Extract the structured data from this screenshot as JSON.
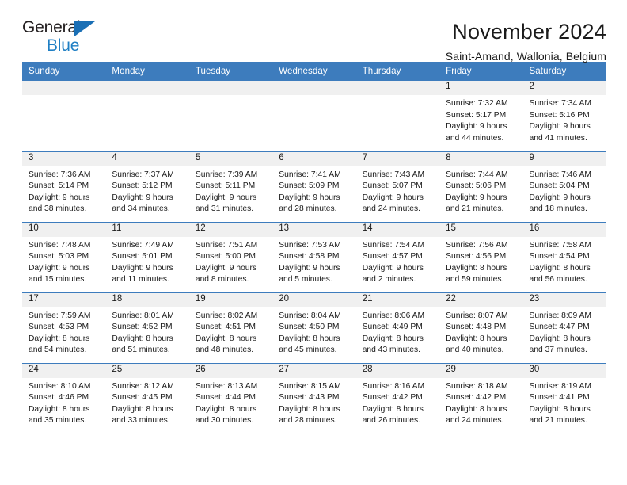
{
  "brand": {
    "name_part1": "General",
    "name_part2": "Blue",
    "triangle_icon": "brand-triangle-icon",
    "accent_color": "#1a6fb5"
  },
  "header": {
    "title": "November 2024",
    "subtitle": "Saint-Amand, Wallonia, Belgium"
  },
  "calendar": {
    "header_color": "#3d7cbd",
    "daynum_strip_color": "#f0f0f0",
    "weekday_headers": [
      "Sunday",
      "Monday",
      "Tuesday",
      "Wednesday",
      "Thursday",
      "Friday",
      "Saturday"
    ],
    "weeks": [
      [
        {
          "day": "",
          "empty": true
        },
        {
          "day": "",
          "empty": true
        },
        {
          "day": "",
          "empty": true
        },
        {
          "day": "",
          "empty": true
        },
        {
          "day": "",
          "empty": true
        },
        {
          "day": "1",
          "sunrise": "Sunrise: 7:32 AM",
          "sunset": "Sunset: 5:17 PM",
          "daylight": "Daylight: 9 hours and 44 minutes."
        },
        {
          "day": "2",
          "sunrise": "Sunrise: 7:34 AM",
          "sunset": "Sunset: 5:16 PM",
          "daylight": "Daylight: 9 hours and 41 minutes."
        }
      ],
      [
        {
          "day": "3",
          "sunrise": "Sunrise: 7:36 AM",
          "sunset": "Sunset: 5:14 PM",
          "daylight": "Daylight: 9 hours and 38 minutes."
        },
        {
          "day": "4",
          "sunrise": "Sunrise: 7:37 AM",
          "sunset": "Sunset: 5:12 PM",
          "daylight": "Daylight: 9 hours and 34 minutes."
        },
        {
          "day": "5",
          "sunrise": "Sunrise: 7:39 AM",
          "sunset": "Sunset: 5:11 PM",
          "daylight": "Daylight: 9 hours and 31 minutes."
        },
        {
          "day": "6",
          "sunrise": "Sunrise: 7:41 AM",
          "sunset": "Sunset: 5:09 PM",
          "daylight": "Daylight: 9 hours and 28 minutes."
        },
        {
          "day": "7",
          "sunrise": "Sunrise: 7:43 AM",
          "sunset": "Sunset: 5:07 PM",
          "daylight": "Daylight: 9 hours and 24 minutes."
        },
        {
          "day": "8",
          "sunrise": "Sunrise: 7:44 AM",
          "sunset": "Sunset: 5:06 PM",
          "daylight": "Daylight: 9 hours and 21 minutes."
        },
        {
          "day": "9",
          "sunrise": "Sunrise: 7:46 AM",
          "sunset": "Sunset: 5:04 PM",
          "daylight": "Daylight: 9 hours and 18 minutes."
        }
      ],
      [
        {
          "day": "10",
          "sunrise": "Sunrise: 7:48 AM",
          "sunset": "Sunset: 5:03 PM",
          "daylight": "Daylight: 9 hours and 15 minutes."
        },
        {
          "day": "11",
          "sunrise": "Sunrise: 7:49 AM",
          "sunset": "Sunset: 5:01 PM",
          "daylight": "Daylight: 9 hours and 11 minutes."
        },
        {
          "day": "12",
          "sunrise": "Sunrise: 7:51 AM",
          "sunset": "Sunset: 5:00 PM",
          "daylight": "Daylight: 9 hours and 8 minutes."
        },
        {
          "day": "13",
          "sunrise": "Sunrise: 7:53 AM",
          "sunset": "Sunset: 4:58 PM",
          "daylight": "Daylight: 9 hours and 5 minutes."
        },
        {
          "day": "14",
          "sunrise": "Sunrise: 7:54 AM",
          "sunset": "Sunset: 4:57 PM",
          "daylight": "Daylight: 9 hours and 2 minutes."
        },
        {
          "day": "15",
          "sunrise": "Sunrise: 7:56 AM",
          "sunset": "Sunset: 4:56 PM",
          "daylight": "Daylight: 8 hours and 59 minutes."
        },
        {
          "day": "16",
          "sunrise": "Sunrise: 7:58 AM",
          "sunset": "Sunset: 4:54 PM",
          "daylight": "Daylight: 8 hours and 56 minutes."
        }
      ],
      [
        {
          "day": "17",
          "sunrise": "Sunrise: 7:59 AM",
          "sunset": "Sunset: 4:53 PM",
          "daylight": "Daylight: 8 hours and 54 minutes."
        },
        {
          "day": "18",
          "sunrise": "Sunrise: 8:01 AM",
          "sunset": "Sunset: 4:52 PM",
          "daylight": "Daylight: 8 hours and 51 minutes."
        },
        {
          "day": "19",
          "sunrise": "Sunrise: 8:02 AM",
          "sunset": "Sunset: 4:51 PM",
          "daylight": "Daylight: 8 hours and 48 minutes."
        },
        {
          "day": "20",
          "sunrise": "Sunrise: 8:04 AM",
          "sunset": "Sunset: 4:50 PM",
          "daylight": "Daylight: 8 hours and 45 minutes."
        },
        {
          "day": "21",
          "sunrise": "Sunrise: 8:06 AM",
          "sunset": "Sunset: 4:49 PM",
          "daylight": "Daylight: 8 hours and 43 minutes."
        },
        {
          "day": "22",
          "sunrise": "Sunrise: 8:07 AM",
          "sunset": "Sunset: 4:48 PM",
          "daylight": "Daylight: 8 hours and 40 minutes."
        },
        {
          "day": "23",
          "sunrise": "Sunrise: 8:09 AM",
          "sunset": "Sunset: 4:47 PM",
          "daylight": "Daylight: 8 hours and 37 minutes."
        }
      ],
      [
        {
          "day": "24",
          "sunrise": "Sunrise: 8:10 AM",
          "sunset": "Sunset: 4:46 PM",
          "daylight": "Daylight: 8 hours and 35 minutes."
        },
        {
          "day": "25",
          "sunrise": "Sunrise: 8:12 AM",
          "sunset": "Sunset: 4:45 PM",
          "daylight": "Daylight: 8 hours and 33 minutes."
        },
        {
          "day": "26",
          "sunrise": "Sunrise: 8:13 AM",
          "sunset": "Sunset: 4:44 PM",
          "daylight": "Daylight: 8 hours and 30 minutes."
        },
        {
          "day": "27",
          "sunrise": "Sunrise: 8:15 AM",
          "sunset": "Sunset: 4:43 PM",
          "daylight": "Daylight: 8 hours and 28 minutes."
        },
        {
          "day": "28",
          "sunrise": "Sunrise: 8:16 AM",
          "sunset": "Sunset: 4:42 PM",
          "daylight": "Daylight: 8 hours and 26 minutes."
        },
        {
          "day": "29",
          "sunrise": "Sunrise: 8:18 AM",
          "sunset": "Sunset: 4:42 PM",
          "daylight": "Daylight: 8 hours and 24 minutes."
        },
        {
          "day": "30",
          "sunrise": "Sunrise: 8:19 AM",
          "sunset": "Sunset: 4:41 PM",
          "daylight": "Daylight: 8 hours and 21 minutes."
        }
      ]
    ]
  }
}
